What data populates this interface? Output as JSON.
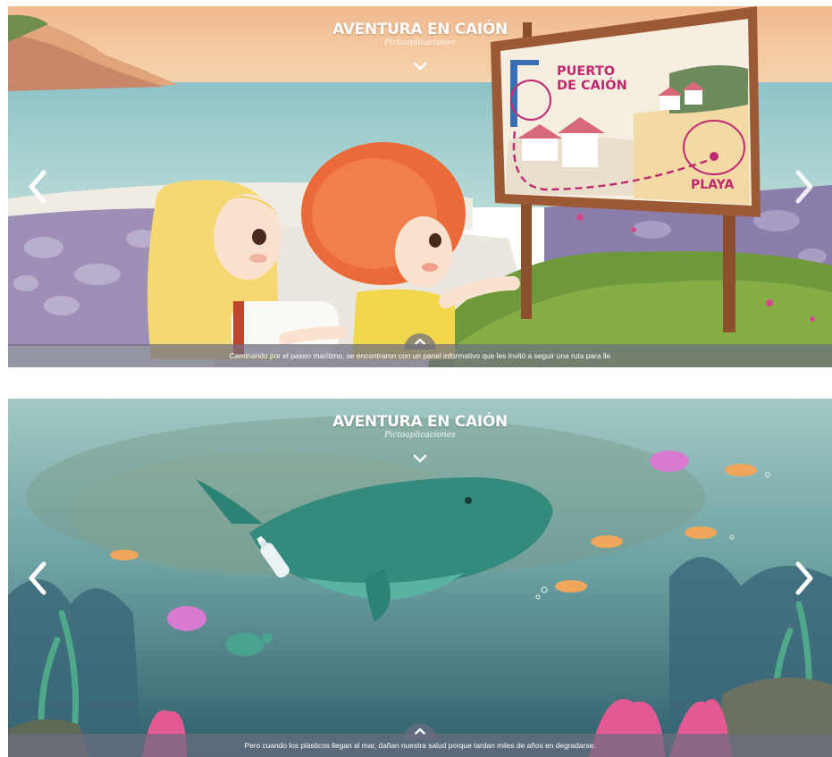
{
  "brand": {
    "title": "AVENTURA EN CAIÓN",
    "subtitle": "Pictoaplicaciones"
  },
  "slides": [
    {
      "sign_labels": {
        "port": "PUERTO\nDE CAIÓN",
        "port_line1": "PUERTO",
        "port_line2": "DE CAIÓN",
        "beach": "PLAYA"
      },
      "caption": "Caminando por el paseo marítimo, se encontraron con un panel informativo que les invitó a seguir una ruta para lle"
    },
    {
      "caption": "Pero cuando los plásticos llegan al mar, dañan nuestra salud porque tardan miles de años en degradarse."
    }
  ],
  "icons": {
    "prev": "chevron-left-icon",
    "next": "chevron-right-icon",
    "collapse": "chevron-down-icon",
    "expand": "chevron-up-icon"
  },
  "colors": {
    "sign_text": "#c0286f",
    "caption_bg": "#6c6e80",
    "sea_top": "#9fc9c7",
    "sky": "#f4c59a"
  }
}
